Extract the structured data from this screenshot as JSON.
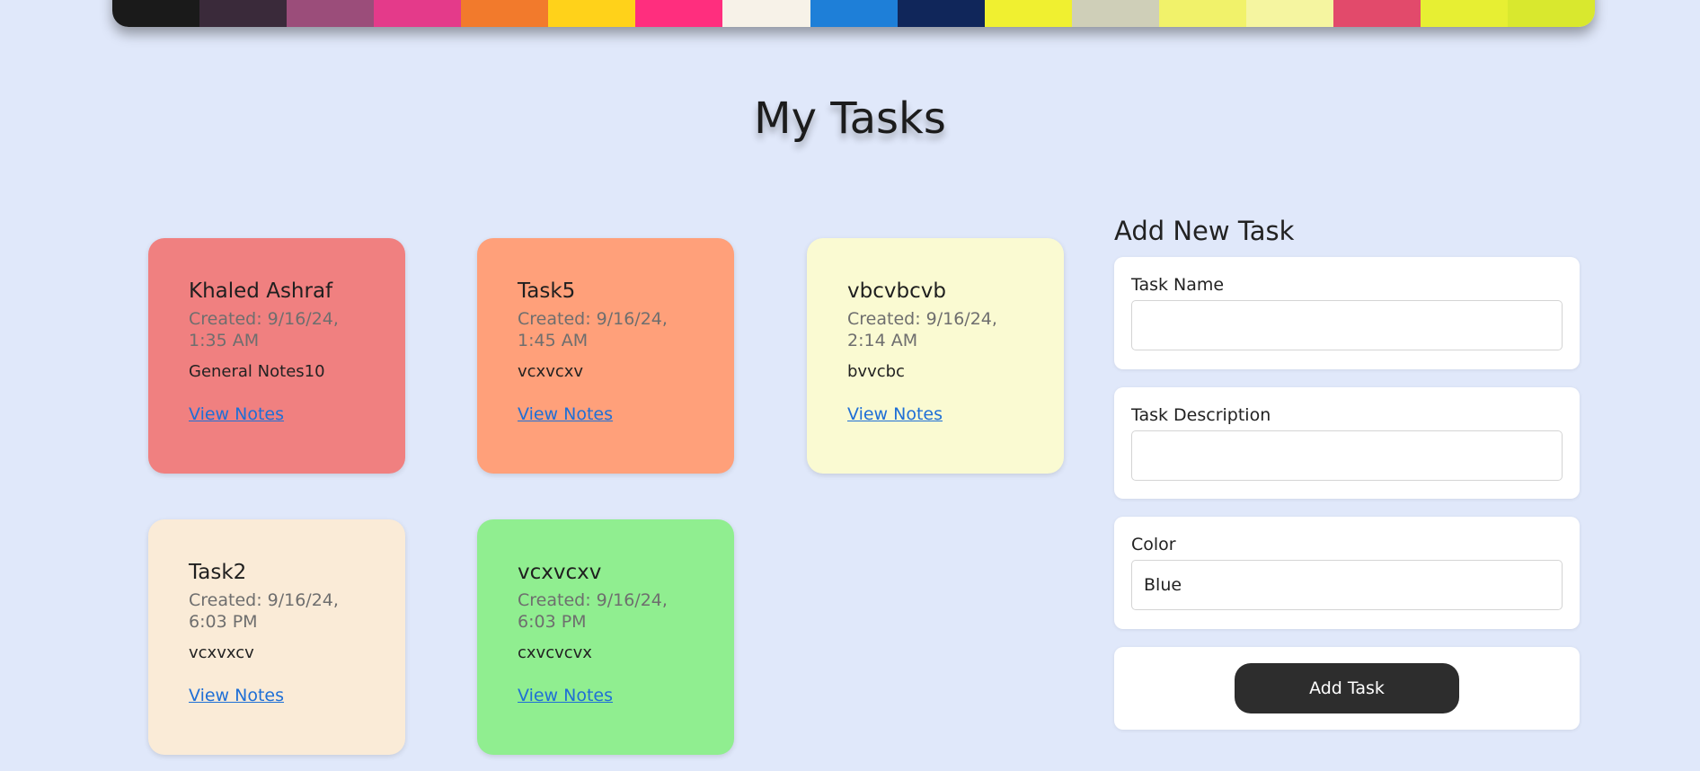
{
  "page": {
    "title": "My Tasks"
  },
  "tasks": [
    {
      "name": "Khaled Ashraf",
      "created": "Created: 9/16/24, 1:35 AM",
      "desc": "General Notes10",
      "link": "View Notes",
      "color": "#f08080"
    },
    {
      "name": "Task5",
      "created": "Created: 9/16/24, 1:45 AM",
      "desc": "vcxvcxv",
      "link": "View Notes",
      "color": "#ffa07a"
    },
    {
      "name": "vbcvbcvb",
      "created": "Created: 9/16/24, 2:14 AM",
      "desc": "bvvcbc",
      "link": "View Notes",
      "color": "#fafad2"
    },
    {
      "name": "Task2",
      "created": "Created: 9/16/24, 6:03 PM",
      "desc": "vcxvxcv",
      "link": "View Notes",
      "color": "#faebd7"
    },
    {
      "name": "vcxvcxv",
      "created": "Created: 9/16/24, 6:03 PM",
      "desc": "cxvcvcvx",
      "link": "View Notes",
      "color": "#90ee90"
    }
  ],
  "form": {
    "title": "Add New Task",
    "task_name_label": "Task Name",
    "task_name_value": "",
    "task_desc_label": "Task Description",
    "task_desc_value": "",
    "color_label": "Color",
    "color_value": "Blue",
    "submit_label": "Add Task"
  },
  "colors": {
    "background": "#e0e8fa",
    "button": "#2d2d2d",
    "link": "#1f6fd6"
  }
}
